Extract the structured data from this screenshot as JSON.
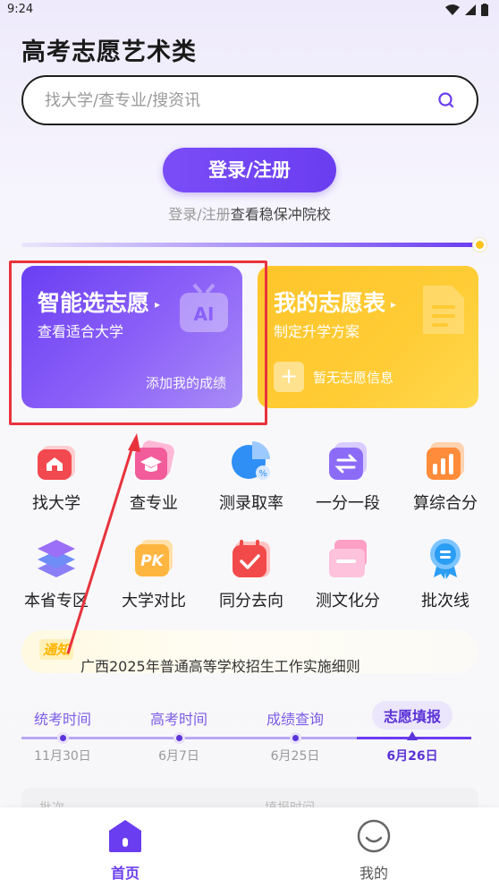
{
  "status_bar": {
    "time": "9:24"
  },
  "app_title": "高考志愿艺术类",
  "search": {
    "placeholder": "找大学/查专业/搜资讯"
  },
  "login": {
    "button_label": "登录/注册",
    "hint_prefix": "登录/注册",
    "hint_suffix": "查看稳保冲院校"
  },
  "progress": {
    "value": 1.0
  },
  "cards": {
    "smart": {
      "title": "智能选志愿",
      "subtitle": "查看适合大学",
      "action": "添加我的成绩",
      "deco_text": "AI"
    },
    "mine": {
      "title": "我的志愿表",
      "subtitle": "制定升学方案",
      "empty_plus": "+",
      "empty_text": "暂无志愿信息"
    }
  },
  "grid": {
    "items": [
      {
        "label": "找大学",
        "icon": "university-icon"
      },
      {
        "label": "查专业",
        "icon": "graduation-cap-icon"
      },
      {
        "label": "测录取率",
        "icon": "pie-chart-icon"
      },
      {
        "label": "一分一段",
        "icon": "swap-icon"
      },
      {
        "label": "算综合分",
        "icon": "bar-chart-icon"
      },
      {
        "label": "本省专区",
        "icon": "layers-icon"
      },
      {
        "label": "大学对比",
        "icon": "pk-icon"
      },
      {
        "label": "同分去向",
        "icon": "calendar-check-icon"
      },
      {
        "label": "测文化分",
        "icon": "document-icon"
      },
      {
        "label": "批次线",
        "icon": "medal-icon"
      }
    ]
  },
  "notice": {
    "tag": "通知",
    "text": "广西2025年普通高等学校招生工作实施细则"
  },
  "timeline": {
    "steps": [
      {
        "label": "统考时间",
        "date": "11月30日"
      },
      {
        "label": "高考时间",
        "date": "6月7日"
      },
      {
        "label": "成绩查询",
        "date": "6月25日"
      },
      {
        "label": "志愿填报",
        "date": "6月26日"
      }
    ]
  },
  "table_peek": {
    "col1": "批次",
    "col2": "填报时间"
  },
  "bottom_nav": {
    "home": "首页",
    "mine": "我的"
  },
  "colors": {
    "accent": "#6a3df0",
    "yellow": "#ffc52b",
    "annotation": "#e8333c"
  }
}
